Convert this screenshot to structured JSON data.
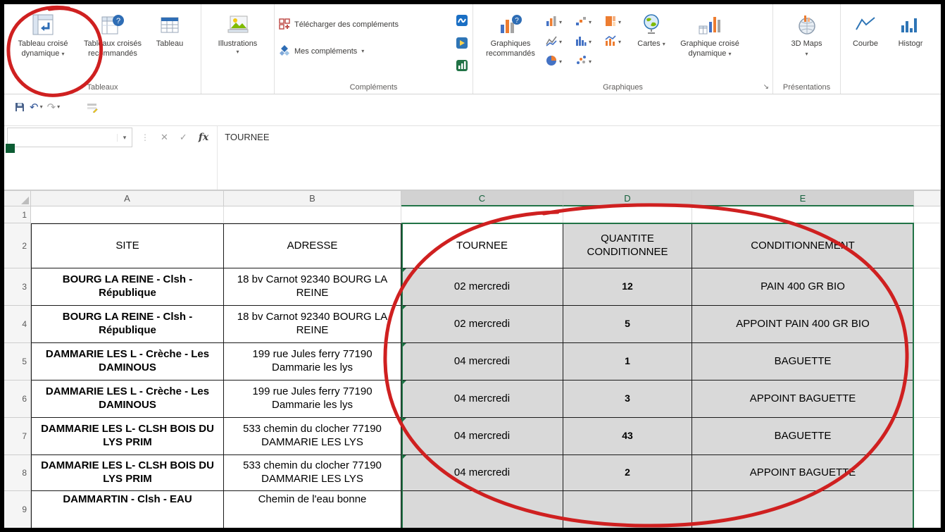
{
  "ribbon": {
    "groups": {
      "tables": {
        "label": "Tableaux",
        "pivot": "Tableau croisé dynamique",
        "recommended_pivots": "Tableaux croisés recommandés",
        "table": "Tableau"
      },
      "illustrations": {
        "button": "Illustrations"
      },
      "addins": {
        "label": "Compléments",
        "get_addins": "Télécharger des compléments",
        "my_addins": "Mes compléments"
      },
      "charts": {
        "label": "Graphiques",
        "recommended": "Graphiques recommandés",
        "maps": "Cartes",
        "pivot_chart": "Graphique croisé dynamique"
      },
      "tours": {
        "label": "Présentations",
        "maps_3d": "3D Maps"
      },
      "sparklines": {
        "line": "Courbe",
        "column": "Histogr"
      }
    }
  },
  "formula_bar": {
    "name_box": "",
    "fx_label": "fx",
    "value": "TOURNEE"
  },
  "sheet": {
    "column_letters": [
      "A",
      "B",
      "C",
      "D",
      "E"
    ],
    "row_numbers": [
      "1",
      "2",
      "3",
      "4",
      "5",
      "6",
      "7",
      "8",
      "9"
    ],
    "header_row": {
      "site": "SITE",
      "adresse": "ADRESSE",
      "tournee": "TOURNEE",
      "quantite": "QUANTITE CONDITIONNEE",
      "conditionnement": "CONDITIONNEMENT"
    },
    "rows": [
      {
        "site": "BOURG LA REINE - Clsh - République",
        "adresse": "18 bv Carnot 92340 BOURG LA REINE",
        "tournee": "02 mercredi",
        "quantite": "12",
        "conditionnement": "PAIN 400 GR BIO"
      },
      {
        "site": "BOURG LA REINE - Clsh - République",
        "adresse": "18 bv Carnot 92340 BOURG LA REINE",
        "tournee": "02 mercredi",
        "quantite": "5",
        "conditionnement": "APPOINT PAIN 400 GR BIO"
      },
      {
        "site": "DAMMARIE LES L - Crèche - Les DAMINOUS",
        "adresse": "199 rue Jules ferry 77190 Dammarie les lys",
        "tournee": "04 mercredi",
        "quantite": "1",
        "conditionnement": "BAGUETTE"
      },
      {
        "site": "DAMMARIE LES L - Crèche - Les DAMINOUS",
        "adresse": "199 rue Jules ferry 77190 Dammarie les lys",
        "tournee": "04 mercredi",
        "quantite": "3",
        "conditionnement": "APPOINT BAGUETTE"
      },
      {
        "site": "DAMMARIE LES L- CLSH BOIS DU LYS PRIM",
        "adresse": "533 chemin du clocher 77190 DAMMARIE LES LYS",
        "tournee": "04 mercredi",
        "quantite": "43",
        "conditionnement": "BAGUETTE"
      },
      {
        "site": "DAMMARIE LES L- CLSH BOIS DU LYS PRIM",
        "adresse": "533 chemin du clocher 77190 DAMMARIE LES LYS",
        "tournee": "04 mercredi",
        "quantite": "2",
        "conditionnement": "APPOINT BAGUETTE"
      }
    ],
    "partial_row": {
      "site": "DAMMARTIN - Clsh - EAU",
      "adresse": "Chemin de l'eau bonne"
    }
  },
  "glyphs": {
    "chevron_down": "▾",
    "undo": "↶",
    "redo": "↷",
    "cancel": "✕",
    "enter": "✓",
    "dialog_launcher": "↘"
  },
  "icons": [
    "pivottable-icon",
    "recommended-pivottable-icon",
    "table-icon",
    "illustrations-icon",
    "get-addins-icon",
    "my-addins-icon",
    "recommended-charts-icon",
    "column-chart-icon",
    "waterfall-chart-icon",
    "hierarchy-chart-icon",
    "line-chart-icon",
    "statistic-chart-icon",
    "combo-chart-icon",
    "pie-chart-icon",
    "scatter-chart-icon",
    "maps-icon",
    "pivot-chart-icon",
    "3d-maps-icon",
    "sparkline-line-icon",
    "sparkline-column-icon",
    "save-icon",
    "error-triangle"
  ],
  "colors": {
    "excel_green": "#217346",
    "annotation_red": "#cf2020",
    "selection_gray": "#d9d9d9"
  }
}
